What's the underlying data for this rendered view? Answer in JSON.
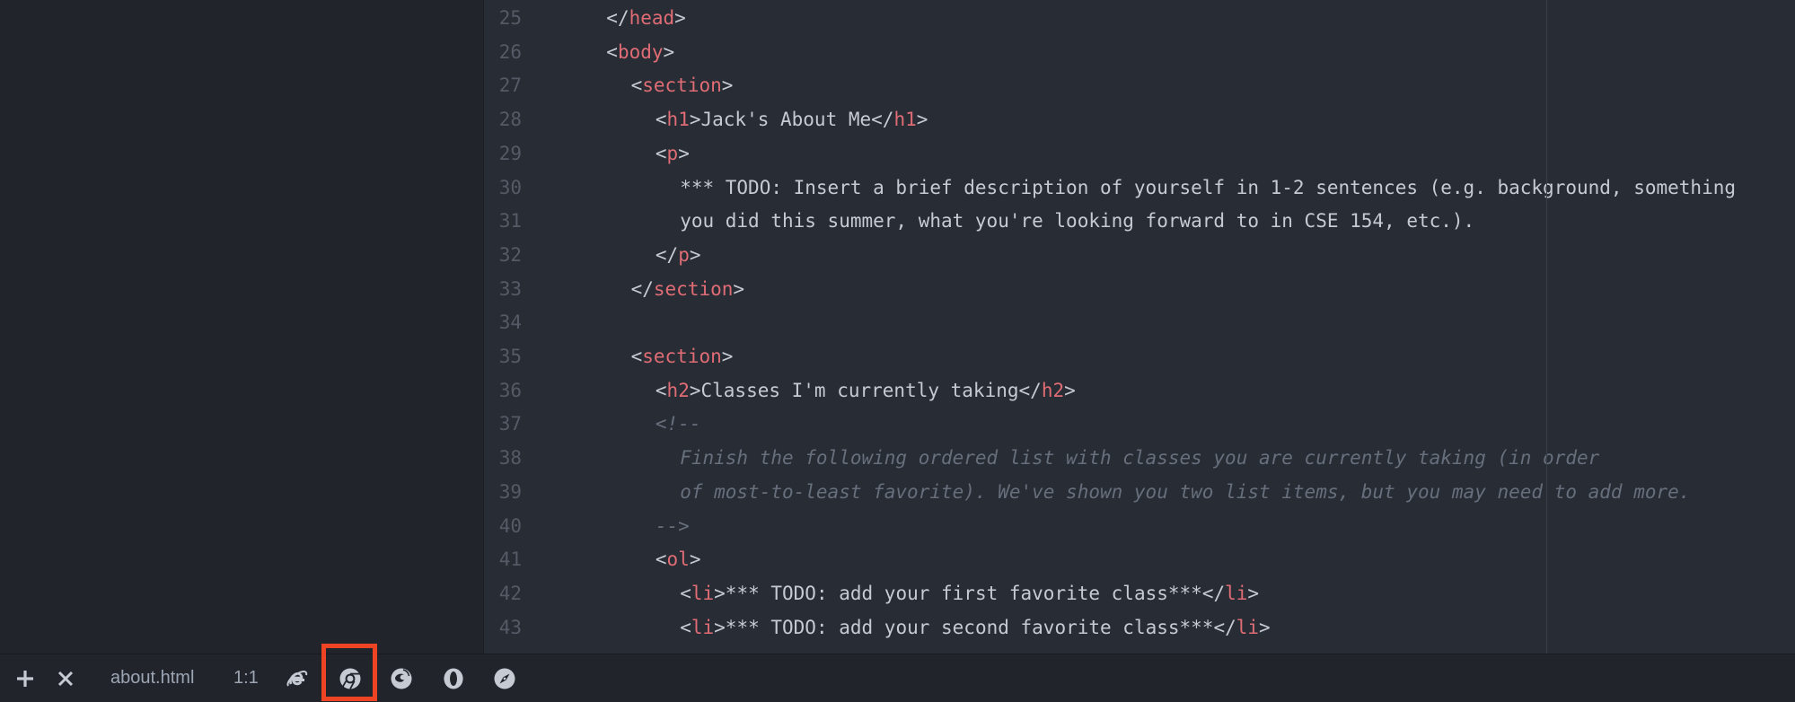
{
  "editor": {
    "lines": [
      {
        "num": "25",
        "ind": 1,
        "segs": [
          {
            "c": "p",
            "t": "</"
          },
          {
            "c": "t",
            "t": "head"
          },
          {
            "c": "p",
            "t": ">"
          }
        ]
      },
      {
        "num": "26",
        "ind": 1,
        "segs": [
          {
            "c": "p",
            "t": "<"
          },
          {
            "c": "t",
            "t": "body"
          },
          {
            "c": "p",
            "t": ">"
          }
        ]
      },
      {
        "num": "27",
        "ind": 2,
        "segs": [
          {
            "c": "p",
            "t": "<"
          },
          {
            "c": "t",
            "t": "section"
          },
          {
            "c": "p",
            "t": ">"
          }
        ]
      },
      {
        "num": "28",
        "ind": 3,
        "segs": [
          {
            "c": "p",
            "t": "<"
          },
          {
            "c": "t",
            "t": "h1"
          },
          {
            "c": "p",
            "t": ">"
          },
          {
            "c": "x",
            "t": "Jack's About Me"
          },
          {
            "c": "p",
            "t": "</"
          },
          {
            "c": "t",
            "t": "h1"
          },
          {
            "c": "p",
            "t": ">"
          }
        ]
      },
      {
        "num": "29",
        "ind": 3,
        "segs": [
          {
            "c": "p",
            "t": "<"
          },
          {
            "c": "t",
            "t": "p"
          },
          {
            "c": "p",
            "t": ">"
          }
        ]
      },
      {
        "num": "30",
        "ind": 4,
        "segs": [
          {
            "c": "x",
            "t": "*** TODO: Insert a brief description of yourself in 1-2 sentences (e.g. background, something"
          }
        ]
      },
      {
        "num": "31",
        "ind": 4,
        "segs": [
          {
            "c": "x",
            "t": "you did this summer, what you're looking forward to in CSE 154, etc.)."
          }
        ]
      },
      {
        "num": "32",
        "ind": 3,
        "segs": [
          {
            "c": "p",
            "t": "</"
          },
          {
            "c": "t",
            "t": "p"
          },
          {
            "c": "p",
            "t": ">"
          }
        ]
      },
      {
        "num": "33",
        "ind": 2,
        "segs": [
          {
            "c": "p",
            "t": "</"
          },
          {
            "c": "t",
            "t": "section"
          },
          {
            "c": "p",
            "t": ">"
          }
        ]
      },
      {
        "num": "34",
        "ind": 0,
        "segs": []
      },
      {
        "num": "35",
        "ind": 2,
        "segs": [
          {
            "c": "p",
            "t": "<"
          },
          {
            "c": "t",
            "t": "section"
          },
          {
            "c": "p",
            "t": ">"
          }
        ]
      },
      {
        "num": "36",
        "ind": 3,
        "segs": [
          {
            "c": "p",
            "t": "<"
          },
          {
            "c": "t",
            "t": "h2"
          },
          {
            "c": "p",
            "t": ">"
          },
          {
            "c": "x",
            "t": "Classes I'm currently taking"
          },
          {
            "c": "p",
            "t": "</"
          },
          {
            "c": "t",
            "t": "h2"
          },
          {
            "c": "p",
            "t": ">"
          }
        ]
      },
      {
        "num": "37",
        "ind": 3,
        "segs": [
          {
            "c": "c",
            "t": "<!--"
          }
        ]
      },
      {
        "num": "38",
        "ind": 4,
        "segs": [
          {
            "c": "c",
            "t": "Finish the following ordered list with classes you are currently taking (in order"
          }
        ]
      },
      {
        "num": "39",
        "ind": 4,
        "segs": [
          {
            "c": "c",
            "t": "of most-to-least favorite). We've shown you two list items, but you may need to add more."
          }
        ]
      },
      {
        "num": "40",
        "ind": 3,
        "segs": [
          {
            "c": "c",
            "t": "-->"
          }
        ]
      },
      {
        "num": "41",
        "ind": 3,
        "segs": [
          {
            "c": "p",
            "t": "<"
          },
          {
            "c": "t",
            "t": "ol"
          },
          {
            "c": "p",
            "t": ">"
          }
        ]
      },
      {
        "num": "42",
        "ind": 4,
        "segs": [
          {
            "c": "p",
            "t": "<"
          },
          {
            "c": "t",
            "t": "li"
          },
          {
            "c": "p",
            "t": ">"
          },
          {
            "c": "x",
            "t": "*** TODO: add your first favorite class***"
          },
          {
            "c": "p",
            "t": "</"
          },
          {
            "c": "t",
            "t": "li"
          },
          {
            "c": "p",
            "t": ">"
          }
        ]
      },
      {
        "num": "43",
        "ind": 4,
        "segs": [
          {
            "c": "p",
            "t": "<"
          },
          {
            "c": "t",
            "t": "li"
          },
          {
            "c": "p",
            "t": ">"
          },
          {
            "c": "x",
            "t": "*** TODO: add your second favorite class***"
          },
          {
            "c": "p",
            "t": "</"
          },
          {
            "c": "t",
            "t": "li"
          },
          {
            "c": "p",
            "t": ">"
          }
        ]
      }
    ]
  },
  "statusbar": {
    "add_icon": "plus-icon",
    "close_icon": "close-icon",
    "filename": "about.html",
    "cursor_position": "1:1",
    "browsers": [
      {
        "name": "internet-explorer-icon"
      },
      {
        "name": "chrome-icon",
        "highlighted": true
      },
      {
        "name": "firefox-icon"
      },
      {
        "name": "opera-icon"
      },
      {
        "name": "safari-icon"
      }
    ]
  },
  "colors": {
    "editor_bg": "#282c34",
    "sidebar_bg": "#21252b",
    "tag": "#e06c75",
    "punctuation": "#c5cad3",
    "comment": "#676f7d",
    "line_number": "#555b66",
    "highlight": "#ef4423"
  }
}
